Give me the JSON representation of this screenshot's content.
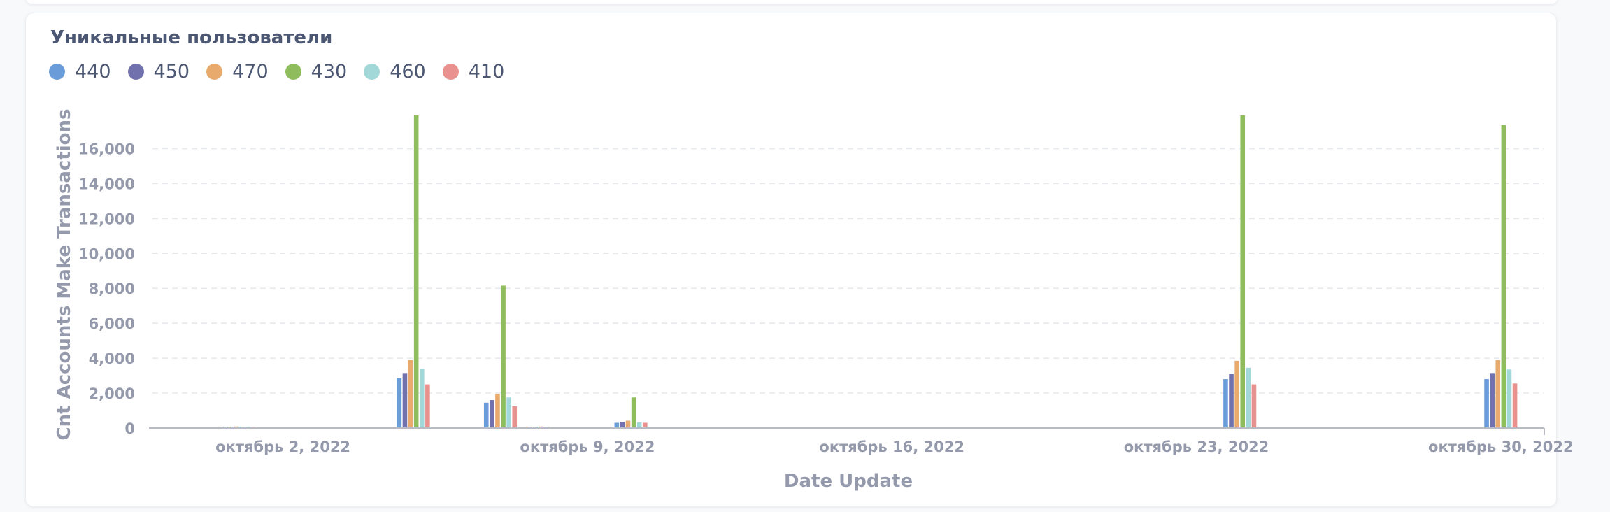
{
  "card": {
    "title": "Уникальные пользователи"
  },
  "chart_data": {
    "type": "bar",
    "xlabel": "Date Update",
    "ylabel": "Cnt Accounts Make Transactions",
    "ylim": [
      0,
      17900
    ],
    "yticks": [
      0,
      2000,
      4000,
      6000,
      8000,
      10000,
      12000,
      14000,
      16000
    ],
    "ytick_labels": [
      "0",
      "2,000",
      "4,000",
      "6,000",
      "8,000",
      "10,000",
      "12,000",
      "14,000",
      "16,000"
    ],
    "grid": true,
    "legend_position": "top-left",
    "x_domain": [
      "2022-09-29",
      "2022-10-31"
    ],
    "x_tick_dates": [
      "2022-10-02",
      "2022-10-09",
      "2022-10-16",
      "2022-10-23",
      "2022-10-30"
    ],
    "x_tick_labels": [
      "октябрь 2, 2022",
      "октябрь 9, 2022",
      "октябрь 16, 2022",
      "октябрь 23, 2022",
      "октябрь 30, 2022"
    ],
    "dates": [
      "2022-10-01",
      "2022-10-05",
      "2022-10-07",
      "2022-10-08",
      "2022-10-10",
      "2022-10-24",
      "2022-10-30"
    ],
    "series": [
      {
        "name": "440",
        "color": "#6a9cd9",
        "values": [
          60,
          2850,
          1450,
          70,
          300,
          2800,
          2800
        ]
      },
      {
        "name": "450",
        "color": "#7172ad",
        "values": [
          80,
          3150,
          1600,
          80,
          350,
          3100,
          3150
        ]
      },
      {
        "name": "470",
        "color": "#e9aa6e",
        "values": [
          90,
          3900,
          1950,
          90,
          420,
          3850,
          3900
        ]
      },
      {
        "name": "430",
        "color": "#8fbc5c",
        "values": [
          60,
          17900,
          8150,
          50,
          1750,
          17900,
          17350
        ]
      },
      {
        "name": "460",
        "color": "#a3d8d8",
        "values": [
          70,
          3400,
          1750,
          40,
          320,
          3450,
          3350
        ]
      },
      {
        "name": "410",
        "color": "#e8918e",
        "values": [
          50,
          2500,
          1250,
          30,
          300,
          2500,
          2550
        ]
      }
    ]
  }
}
